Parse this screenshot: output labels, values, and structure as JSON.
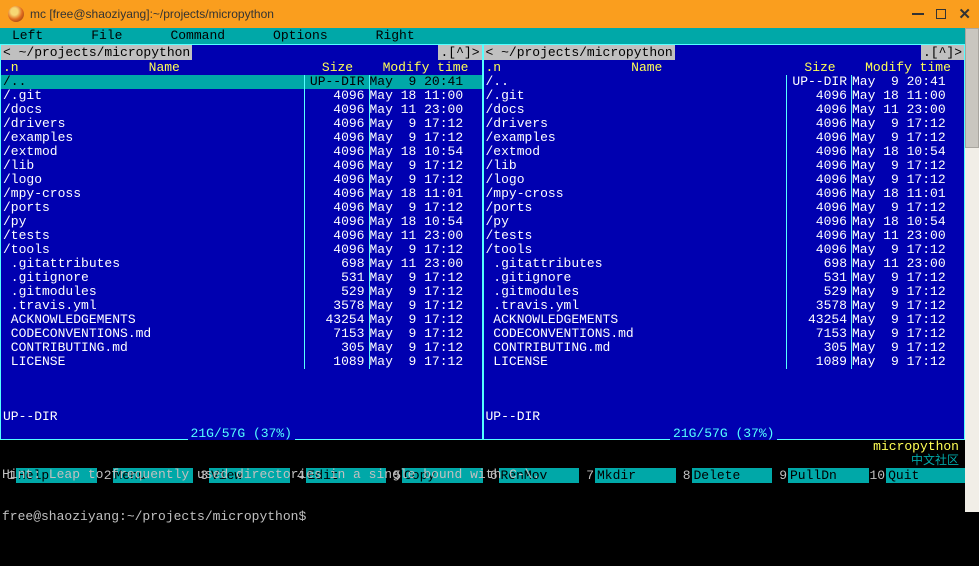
{
  "window": {
    "title": "mc [free@shaoziyang]:~/projects/micropython"
  },
  "menu": {
    "items": [
      "Left",
      "File",
      "Command",
      "Options",
      "Right"
    ]
  },
  "panel_left": {
    "path": "<   ~/projects/micropython",
    "arrows": ".[^]>",
    "headers": {
      "n": ".n",
      "name": "Name",
      "size": "Size",
      "mtime": "Modify time"
    },
    "footer": "UP--DIR",
    "disk": "21G/57G (37%)",
    "rows": [
      {
        "name": "/..",
        "size": "UP--DIR",
        "mtime": "May  9 20:41",
        "selected": true
      },
      {
        "name": "/.git",
        "size": "4096",
        "mtime": "May 18 11:00"
      },
      {
        "name": "/docs",
        "size": "4096",
        "mtime": "May 11 23:00"
      },
      {
        "name": "/drivers",
        "size": "4096",
        "mtime": "May  9 17:12"
      },
      {
        "name": "/examples",
        "size": "4096",
        "mtime": "May  9 17:12"
      },
      {
        "name": "/extmod",
        "size": "4096",
        "mtime": "May 18 10:54"
      },
      {
        "name": "/lib",
        "size": "4096",
        "mtime": "May  9 17:12"
      },
      {
        "name": "/logo",
        "size": "4096",
        "mtime": "May  9 17:12"
      },
      {
        "name": "/mpy-cross",
        "size": "4096",
        "mtime": "May 18 11:01"
      },
      {
        "name": "/ports",
        "size": "4096",
        "mtime": "May  9 17:12"
      },
      {
        "name": "/py",
        "size": "4096",
        "mtime": "May 18 10:54"
      },
      {
        "name": "/tests",
        "size": "4096",
        "mtime": "May 11 23:00"
      },
      {
        "name": "/tools",
        "size": "4096",
        "mtime": "May  9 17:12"
      },
      {
        "name": " .gitattributes",
        "size": "698",
        "mtime": "May 11 23:00"
      },
      {
        "name": " .gitignore",
        "size": "531",
        "mtime": "May  9 17:12"
      },
      {
        "name": " .gitmodules",
        "size": "529",
        "mtime": "May  9 17:12"
      },
      {
        "name": " .travis.yml",
        "size": "3578",
        "mtime": "May  9 17:12"
      },
      {
        "name": " ACKNOWLEDGEMENTS",
        "size": "43254",
        "mtime": "May  9 17:12"
      },
      {
        "name": " CODECONVENTIONS.md",
        "size": "7153",
        "mtime": "May  9 17:12"
      },
      {
        "name": " CONTRIBUTING.md",
        "size": "305",
        "mtime": "May  9 17:12"
      },
      {
        "name": " LICENSE",
        "size": "1089",
        "mtime": "May  9 17:12"
      }
    ]
  },
  "panel_right": {
    "path": "<   ~/projects/micropython",
    "arrows": ".[^]>",
    "headers": {
      "n": ".n",
      "name": "Name",
      "size": "Size",
      "mtime": "Modify time"
    },
    "footer": "UP--DIR",
    "disk": "21G/57G (37%)",
    "rows": [
      {
        "name": "/..",
        "size": "UP--DIR",
        "mtime": "May  9 20:41"
      },
      {
        "name": "/.git",
        "size": "4096",
        "mtime": "May 18 11:00"
      },
      {
        "name": "/docs",
        "size": "4096",
        "mtime": "May 11 23:00"
      },
      {
        "name": "/drivers",
        "size": "4096",
        "mtime": "May  9 17:12"
      },
      {
        "name": "/examples",
        "size": "4096",
        "mtime": "May  9 17:12"
      },
      {
        "name": "/extmod",
        "size": "4096",
        "mtime": "May 18 10:54"
      },
      {
        "name": "/lib",
        "size": "4096",
        "mtime": "May  9 17:12"
      },
      {
        "name": "/logo",
        "size": "4096",
        "mtime": "May  9 17:12"
      },
      {
        "name": "/mpy-cross",
        "size": "4096",
        "mtime": "May 18 11:01"
      },
      {
        "name": "/ports",
        "size": "4096",
        "mtime": "May  9 17:12"
      },
      {
        "name": "/py",
        "size": "4096",
        "mtime": "May 18 10:54"
      },
      {
        "name": "/tests",
        "size": "4096",
        "mtime": "May 11 23:00"
      },
      {
        "name": "/tools",
        "size": "4096",
        "mtime": "May  9 17:12"
      },
      {
        "name": " .gitattributes",
        "size": "698",
        "mtime": "May 11 23:00"
      },
      {
        "name": " .gitignore",
        "size": "531",
        "mtime": "May  9 17:12"
      },
      {
        "name": " .gitmodules",
        "size": "529",
        "mtime": "May  9 17:12"
      },
      {
        "name": " .travis.yml",
        "size": "3578",
        "mtime": "May  9 17:12"
      },
      {
        "name": " ACKNOWLEDGEMENTS",
        "size": "43254",
        "mtime": "May  9 17:12"
      },
      {
        "name": " CODECONVENTIONS.md",
        "size": "7153",
        "mtime": "May  9 17:12"
      },
      {
        "name": " CONTRIBUTING.md",
        "size": "305",
        "mtime": "May  9 17:12"
      },
      {
        "name": " LICENSE",
        "size": "1089",
        "mtime": "May  9 17:12"
      }
    ]
  },
  "hint": "Hint: Leap to frequently used directories in a single bound with C-\\.",
  "prompt": "free@shaoziyang:~/projects/micropython$ ",
  "brand": "micropython",
  "brand_cn": "中文社区",
  "fkeys": [
    {
      "n": "1",
      "label": "Help"
    },
    {
      "n": "2",
      "label": "Menu"
    },
    {
      "n": "3",
      "label": "View"
    },
    {
      "n": "4",
      "label": "Edit"
    },
    {
      "n": "5",
      "label": "Copy"
    },
    {
      "n": "6",
      "label": "RenMov"
    },
    {
      "n": "7",
      "label": "Mkdir"
    },
    {
      "n": "8",
      "label": "Delete"
    },
    {
      "n": "9",
      "label": "PullDn"
    },
    {
      "n": "10",
      "label": "Quit"
    }
  ]
}
